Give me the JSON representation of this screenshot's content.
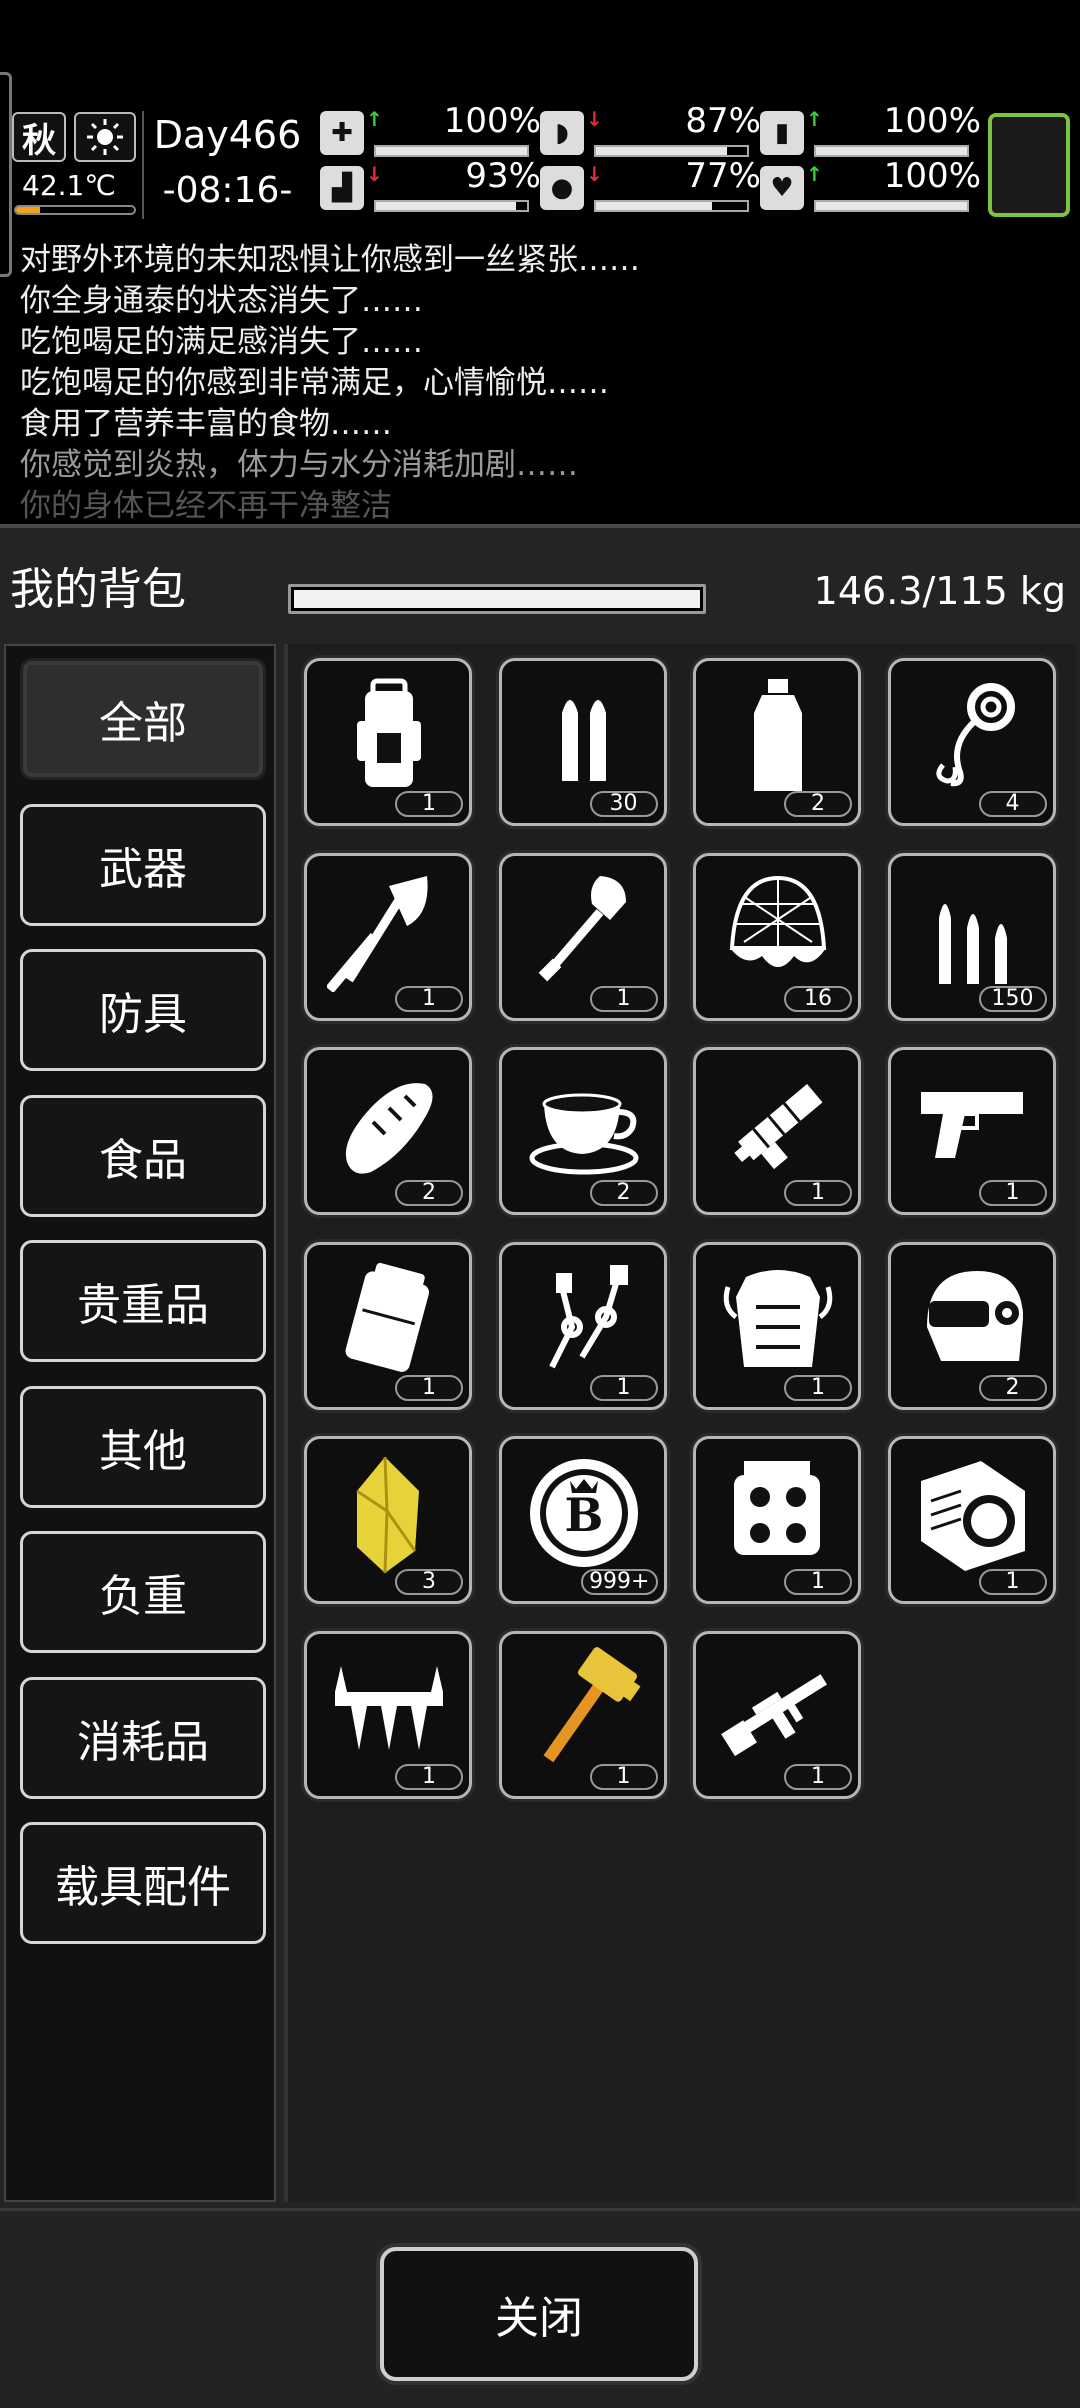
{
  "status": {
    "season": "秋",
    "temperature": "42.1℃",
    "temperature_level": 0.2,
    "day": "Day466",
    "time": "-08:16-",
    "stats": [
      {
        "name": "health-icon",
        "arrow": "up",
        "value": "100%",
        "level": 1.0
      },
      {
        "name": "stomach-icon",
        "arrow": "down",
        "value": "87%",
        "level": 0.87
      },
      {
        "name": "pill-icon",
        "arrow": "up",
        "value": "100%",
        "level": 1.0
      },
      {
        "name": "boot-icon",
        "arrow": "down",
        "value": "93%",
        "level": 0.93
      },
      {
        "name": "water-drop-icon",
        "arrow": "down",
        "value": "77%",
        "level": 0.77
      },
      {
        "name": "heart-icon",
        "arrow": "up",
        "value": "100%",
        "level": 1.0
      }
    ],
    "arrow_up_color": "#3ccf3c",
    "arrow_down_color": "#e03030",
    "corner_color": "#7cc341"
  },
  "log": [
    "对野外环境的未知恐惧让你感到一丝紧张……",
    "你全身通泰的状态消失了……",
    "吃饱喝足的满足感消失了……",
    "吃饱喝足的你感到非常满足，心情愉悦……",
    "食用了营养丰富的食物……",
    "你感觉到炎热，体力与水分消耗加剧……",
    "你的身体已经不再干净整洁"
  ],
  "backpack": {
    "title": "我的背包",
    "weight": "146.3/115 kg",
    "weight_level": 1.0
  },
  "categories": [
    "全部",
    "武器",
    "防具",
    "食品",
    "贵重品",
    "其他",
    "负重",
    "消耗品",
    "载具配件"
  ],
  "selected_category": "全部",
  "items": [
    {
      "icon": "backpack-icon",
      "count": "1"
    },
    {
      "icon": "bullets-icon",
      "count": "30"
    },
    {
      "icon": "water-bottle-icon",
      "count": "2"
    },
    {
      "icon": "rope-icon",
      "count": "4"
    },
    {
      "icon": "axe-icon",
      "count": "1"
    },
    {
      "icon": "shovel-icon",
      "count": "1"
    },
    {
      "icon": "net-icon",
      "count": "16"
    },
    {
      "icon": "rifle-ammo-icon",
      "count": "150"
    },
    {
      "icon": "bread-icon",
      "count": "2"
    },
    {
      "icon": "coffee-cup-icon",
      "count": "2"
    },
    {
      "icon": "minigun-icon",
      "count": "1"
    },
    {
      "icon": "pistol-icon",
      "count": "1"
    },
    {
      "icon": "armor-plate-icon",
      "count": "1"
    },
    {
      "icon": "mechanical-arm-icon",
      "count": "1"
    },
    {
      "icon": "chest-armor-icon",
      "count": "1"
    },
    {
      "icon": "helmet-icon",
      "count": "2"
    },
    {
      "icon": "gold-crystal-icon",
      "count": "3"
    },
    {
      "icon": "coin-b-icon",
      "count": "999+",
      "coin_letter": "B"
    },
    {
      "icon": "engine-icon",
      "count": "1"
    },
    {
      "icon": "engine-block-icon",
      "count": "1"
    },
    {
      "icon": "spiked-bar-icon",
      "count": "1"
    },
    {
      "icon": "golden-hammer-icon",
      "count": "1"
    },
    {
      "icon": "assault-rifle-icon",
      "count": "1"
    }
  ],
  "close_label": "关闭"
}
